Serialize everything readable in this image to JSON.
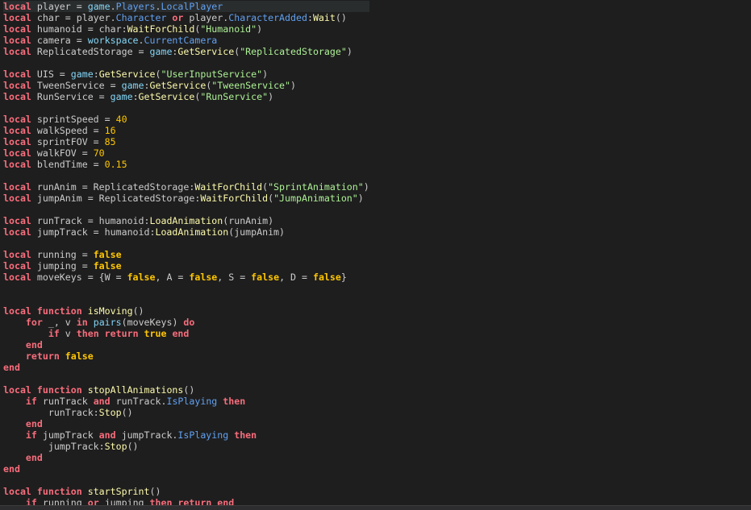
{
  "colors": {
    "background": "#1e1e1e",
    "keyword": "#f86d7c",
    "boolean": "#ffc600",
    "string": "#adf195",
    "number": "#ffc600",
    "property": "#61a1f1",
    "builtin": "#84d6f7",
    "function": "#fdfbac",
    "identifier": "#cccccc"
  },
  "editor": {
    "current_line": 1,
    "lines": [
      [
        [
          "kw",
          "local"
        ],
        [
          "id",
          " player = "
        ],
        [
          "builtin",
          "game"
        ],
        [
          "id",
          "."
        ],
        [
          "prop",
          "Players"
        ],
        [
          "id",
          "."
        ],
        [
          "prop",
          "LocalPlayer"
        ]
      ],
      [
        [
          "kw",
          "local"
        ],
        [
          "id",
          " char = player."
        ],
        [
          "prop",
          "Character"
        ],
        [
          "id",
          " "
        ],
        [
          "kw",
          "or"
        ],
        [
          "id",
          " player."
        ],
        [
          "prop",
          "CharacterAdded"
        ],
        [
          "id",
          ":"
        ],
        [
          "fn",
          "Wait"
        ],
        [
          "id",
          "()"
        ]
      ],
      [
        [
          "kw",
          "local"
        ],
        [
          "id",
          " humanoid = char:"
        ],
        [
          "fn",
          "WaitForChild"
        ],
        [
          "id",
          "("
        ],
        [
          "str",
          "\"Humanoid\""
        ],
        [
          "id",
          ")"
        ]
      ],
      [
        [
          "kw",
          "local"
        ],
        [
          "id",
          " camera = "
        ],
        [
          "builtin",
          "workspace"
        ],
        [
          "id",
          "."
        ],
        [
          "prop",
          "CurrentCamera"
        ]
      ],
      [
        [
          "kw",
          "local"
        ],
        [
          "id",
          " ReplicatedStorage = "
        ],
        [
          "builtin",
          "game"
        ],
        [
          "id",
          ":"
        ],
        [
          "fn",
          "GetService"
        ],
        [
          "id",
          "("
        ],
        [
          "str",
          "\"ReplicatedStorage\""
        ],
        [
          "id",
          ")"
        ]
      ],
      [],
      [
        [
          "kw",
          "local"
        ],
        [
          "id",
          " UIS = "
        ],
        [
          "builtin",
          "game"
        ],
        [
          "id",
          ":"
        ],
        [
          "fn",
          "GetService"
        ],
        [
          "id",
          "("
        ],
        [
          "str",
          "\"UserInputService\""
        ],
        [
          "id",
          ")"
        ]
      ],
      [
        [
          "kw",
          "local"
        ],
        [
          "id",
          " TweenService = "
        ],
        [
          "builtin",
          "game"
        ],
        [
          "id",
          ":"
        ],
        [
          "fn",
          "GetService"
        ],
        [
          "id",
          "("
        ],
        [
          "str",
          "\"TweenService\""
        ],
        [
          "id",
          ")"
        ]
      ],
      [
        [
          "kw",
          "local"
        ],
        [
          "id",
          " RunService = "
        ],
        [
          "builtin",
          "game"
        ],
        [
          "id",
          ":"
        ],
        [
          "fn",
          "GetService"
        ],
        [
          "id",
          "("
        ],
        [
          "str",
          "\"RunService\""
        ],
        [
          "id",
          ")"
        ]
      ],
      [],
      [
        [
          "kw",
          "local"
        ],
        [
          "id",
          " sprintSpeed = "
        ],
        [
          "num",
          "40"
        ]
      ],
      [
        [
          "kw",
          "local"
        ],
        [
          "id",
          " walkSpeed = "
        ],
        [
          "num",
          "16"
        ]
      ],
      [
        [
          "kw",
          "local"
        ],
        [
          "id",
          " sprintFOV = "
        ],
        [
          "num",
          "85"
        ]
      ],
      [
        [
          "kw",
          "local"
        ],
        [
          "id",
          " walkFOV = "
        ],
        [
          "num",
          "70"
        ]
      ],
      [
        [
          "kw",
          "local"
        ],
        [
          "id",
          " blendTime = "
        ],
        [
          "num",
          "0.15"
        ]
      ],
      [],
      [
        [
          "kw",
          "local"
        ],
        [
          "id",
          " runAnim = ReplicatedStorage:"
        ],
        [
          "fn",
          "WaitForChild"
        ],
        [
          "id",
          "("
        ],
        [
          "str",
          "\"SprintAnimation\""
        ],
        [
          "id",
          ")"
        ]
      ],
      [
        [
          "kw",
          "local"
        ],
        [
          "id",
          " jumpAnim = ReplicatedStorage:"
        ],
        [
          "fn",
          "WaitForChild"
        ],
        [
          "id",
          "("
        ],
        [
          "str",
          "\"JumpAnimation\""
        ],
        [
          "id",
          ")"
        ]
      ],
      [],
      [
        [
          "kw",
          "local"
        ],
        [
          "id",
          " runTrack = humanoid:"
        ],
        [
          "fn",
          "LoadAnimation"
        ],
        [
          "id",
          "(runAnim)"
        ]
      ],
      [
        [
          "kw",
          "local"
        ],
        [
          "id",
          " jumpTrack = humanoid:"
        ],
        [
          "fn",
          "LoadAnimation"
        ],
        [
          "id",
          "(jumpAnim)"
        ]
      ],
      [],
      [
        [
          "kw",
          "local"
        ],
        [
          "id",
          " running = "
        ],
        [
          "bool",
          "false"
        ]
      ],
      [
        [
          "kw",
          "local"
        ],
        [
          "id",
          " jumping = "
        ],
        [
          "bool",
          "false"
        ]
      ],
      [
        [
          "kw",
          "local"
        ],
        [
          "id",
          " moveKeys = {W = "
        ],
        [
          "bool",
          "false"
        ],
        [
          "id",
          ", A = "
        ],
        [
          "bool",
          "false"
        ],
        [
          "id",
          ", S = "
        ],
        [
          "bool",
          "false"
        ],
        [
          "id",
          ", D = "
        ],
        [
          "bool",
          "false"
        ],
        [
          "id",
          "}"
        ]
      ],
      [],
      [],
      [
        [
          "kw",
          "local"
        ],
        [
          "id",
          " "
        ],
        [
          "kw",
          "function"
        ],
        [
          "id",
          " "
        ],
        [
          "fn",
          "isMoving"
        ],
        [
          "id",
          "()"
        ]
      ],
      [
        [
          "id",
          "    "
        ],
        [
          "kw",
          "for"
        ],
        [
          "id",
          " _, v "
        ],
        [
          "kw",
          "in"
        ],
        [
          "id",
          " "
        ],
        [
          "builtin",
          "pairs"
        ],
        [
          "id",
          "(moveKeys) "
        ],
        [
          "kw",
          "do"
        ]
      ],
      [
        [
          "id",
          "        "
        ],
        [
          "kw",
          "if"
        ],
        [
          "id",
          " v "
        ],
        [
          "kw",
          "then"
        ],
        [
          "id",
          " "
        ],
        [
          "kw",
          "return"
        ],
        [
          "id",
          " "
        ],
        [
          "bool",
          "true"
        ],
        [
          "id",
          " "
        ],
        [
          "kw",
          "end"
        ]
      ],
      [
        [
          "id",
          "    "
        ],
        [
          "kw",
          "end"
        ]
      ],
      [
        [
          "id",
          "    "
        ],
        [
          "kw",
          "return"
        ],
        [
          "id",
          " "
        ],
        [
          "bool",
          "false"
        ]
      ],
      [
        [
          "kw",
          "end"
        ]
      ],
      [],
      [
        [
          "kw",
          "local"
        ],
        [
          "id",
          " "
        ],
        [
          "kw",
          "function"
        ],
        [
          "id",
          " "
        ],
        [
          "fn",
          "stopAllAnimations"
        ],
        [
          "id",
          "()"
        ]
      ],
      [
        [
          "id",
          "    "
        ],
        [
          "kw",
          "if"
        ],
        [
          "id",
          " runTrack "
        ],
        [
          "kw",
          "and"
        ],
        [
          "id",
          " runTrack."
        ],
        [
          "prop",
          "IsPlaying"
        ],
        [
          "id",
          " "
        ],
        [
          "kw",
          "then"
        ]
      ],
      [
        [
          "id",
          "        runTrack:"
        ],
        [
          "fn",
          "Stop"
        ],
        [
          "id",
          "()"
        ]
      ],
      [
        [
          "id",
          "    "
        ],
        [
          "kw",
          "end"
        ]
      ],
      [
        [
          "id",
          "    "
        ],
        [
          "kw",
          "if"
        ],
        [
          "id",
          " jumpTrack "
        ],
        [
          "kw",
          "and"
        ],
        [
          "id",
          " jumpTrack."
        ],
        [
          "prop",
          "IsPlaying"
        ],
        [
          "id",
          " "
        ],
        [
          "kw",
          "then"
        ]
      ],
      [
        [
          "id",
          "        jumpTrack:"
        ],
        [
          "fn",
          "Stop"
        ],
        [
          "id",
          "()"
        ]
      ],
      [
        [
          "id",
          "    "
        ],
        [
          "kw",
          "end"
        ]
      ],
      [
        [
          "kw",
          "end"
        ]
      ],
      [],
      [
        [
          "kw",
          "local"
        ],
        [
          "id",
          " "
        ],
        [
          "kw",
          "function"
        ],
        [
          "id",
          " "
        ],
        [
          "fn",
          "startSprint"
        ],
        [
          "id",
          "()"
        ]
      ],
      [
        [
          "id",
          "    "
        ],
        [
          "kw",
          "if"
        ],
        [
          "id",
          " running "
        ],
        [
          "kw",
          "or"
        ],
        [
          "id",
          " jumping "
        ],
        [
          "kw",
          "then"
        ],
        [
          "id",
          " "
        ],
        [
          "kw",
          "return"
        ],
        [
          "id",
          " "
        ],
        [
          "kw",
          "end"
        ]
      ]
    ]
  }
}
